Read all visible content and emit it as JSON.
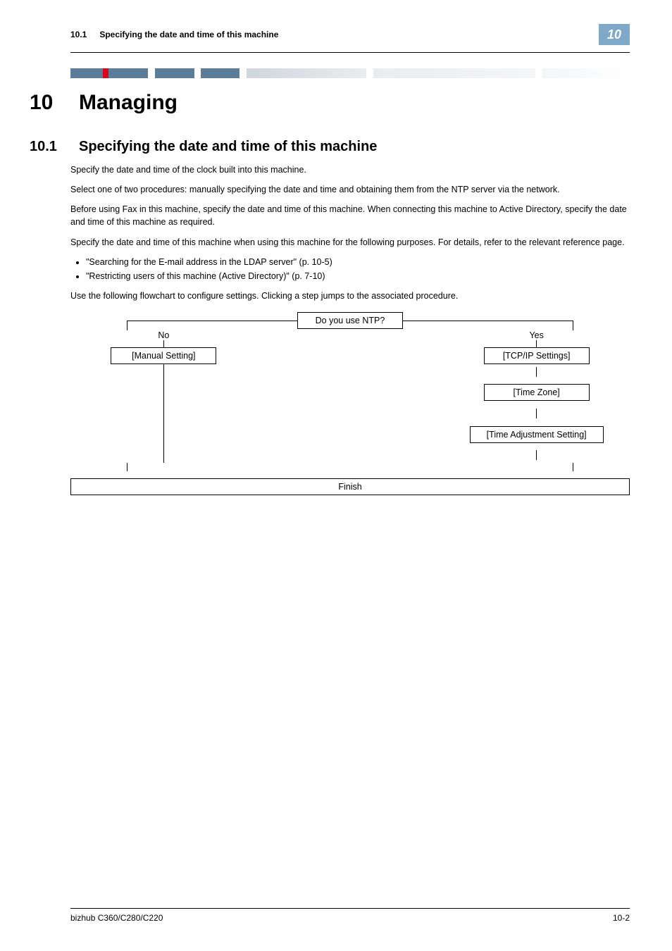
{
  "header": {
    "section_number": "10.1",
    "section_title": "Specifying the date and time of this machine",
    "chapter_tab": "10"
  },
  "chapter": {
    "number": "10",
    "title": "Managing"
  },
  "section": {
    "number": "10.1",
    "title": "Specifying the date and time of this machine"
  },
  "body": {
    "p1": "Specify the date and time of the clock built into this machine.",
    "p2": "Select one of two procedures: manually specifying the date and time and obtaining them from the NTP server via the network.",
    "p3": "Before using Fax in this machine, specify the date and time of this machine. When connecting this machine to Active Directory, specify the date and time of this machine as required.",
    "p4": "Specify the date and time of this machine when using this machine for the following purposes. For details, refer to the relevant reference page.",
    "bullets": [
      "\"Searching for the E-mail address in the LDAP server\" (p. 10-5)",
      "\"Restricting users of this machine (Active Directory)\" (p. 7-10)"
    ],
    "p5": "Use the following flowchart to configure settings. Clicking a step jumps to the associated procedure."
  },
  "flowchart": {
    "question": "Do you use NTP?",
    "no_label": "No",
    "yes_label": "Yes",
    "manual_setting": "[Manual Setting]",
    "tcpip_settings": "[TCP/IP Settings]",
    "time_zone": "[Time Zone]",
    "time_adjustment": "[Time Adjustment Setting]",
    "finish": "Finish"
  },
  "footer": {
    "product": "bizhub C360/C280/C220",
    "page": "10-2"
  }
}
